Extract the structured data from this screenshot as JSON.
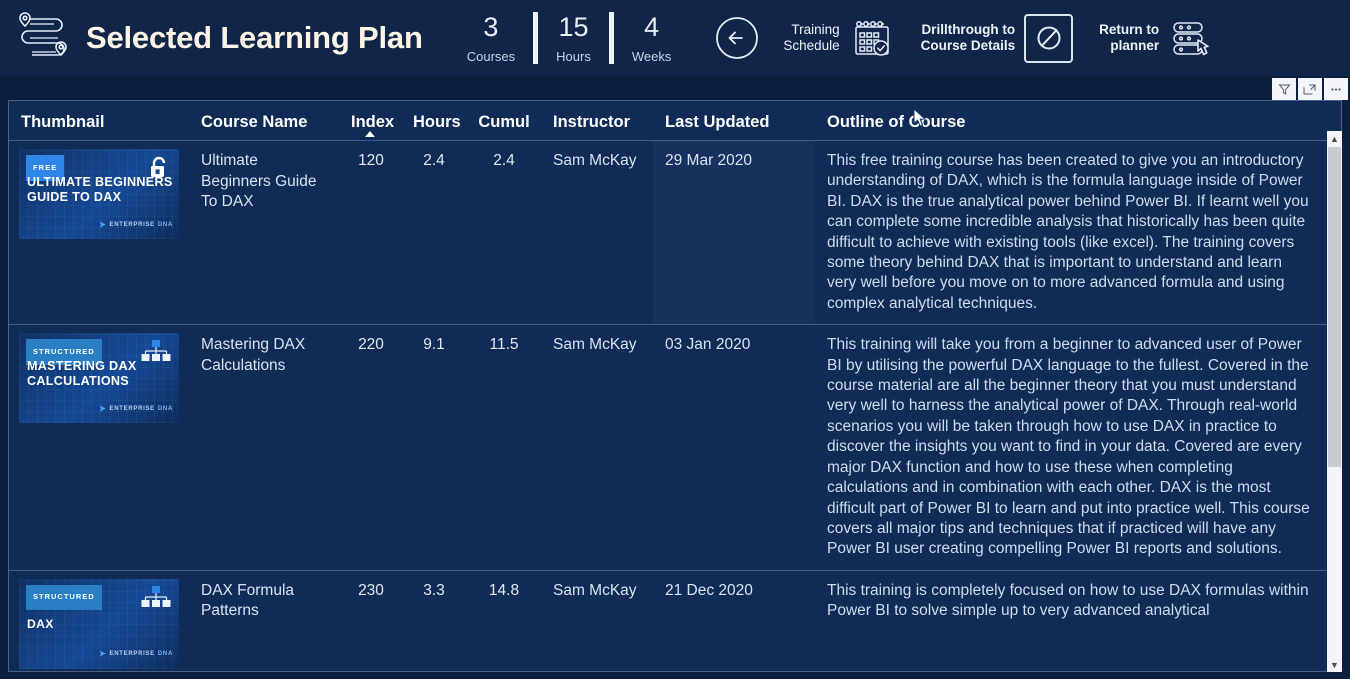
{
  "header": {
    "plan_icon": "route-plan-icon",
    "title": "Selected Learning Plan",
    "metrics": [
      {
        "value": "3",
        "label": "Courses"
      },
      {
        "value": "15",
        "label": "Hours"
      },
      {
        "value": "4",
        "label": "Weeks"
      }
    ],
    "back_button": {
      "name": "back-arrow-button"
    },
    "actions": [
      {
        "label": "Training\nSchedule",
        "bold": false,
        "icon": "calendar-check-icon",
        "framed": false
      },
      {
        "label": "Drillthrough to\nCourse Details",
        "bold": true,
        "icon": "no-entry-slash-icon",
        "framed": true
      },
      {
        "label": "Return to\nplanner",
        "bold": true,
        "icon": "database-click-icon",
        "framed": false
      }
    ]
  },
  "visual_tools": [
    {
      "name": "filter-icon",
      "glyph": "filter"
    },
    {
      "name": "focus-mode-icon",
      "glyph": "focus"
    },
    {
      "name": "more-options-icon",
      "glyph": "more"
    }
  ],
  "table": {
    "columns": [
      {
        "key": "thumbnail",
        "label": "Thumbnail",
        "align": "left",
        "sorted": false
      },
      {
        "key": "name",
        "label": "Course Name",
        "align": "left",
        "sorted": false
      },
      {
        "key": "index",
        "label": "Index",
        "align": "center",
        "sorted": "asc"
      },
      {
        "key": "hours",
        "label": "Hours",
        "align": "center",
        "sorted": false
      },
      {
        "key": "cumul",
        "label": "Cumul",
        "align": "center",
        "sorted": false
      },
      {
        "key": "instructor",
        "label": "Instructor",
        "align": "left",
        "sorted": false
      },
      {
        "key": "updated",
        "label": "Last Updated",
        "align": "left",
        "sorted": false
      },
      {
        "key": "outline",
        "label": "Outline of Course",
        "align": "left",
        "sorted": false
      }
    ],
    "rows": [
      {
        "thumbnail": {
          "badge": "FREE",
          "badge_type": "free",
          "title": "Ultimate Beginners Guide To DAX",
          "icon": "unlock-icon",
          "brand": "ENTERPRISE",
          "brand_suffix": "DNA"
        },
        "name": "Ultimate Beginners Guide To DAX",
        "index": "120",
        "hours": "2.4",
        "cumul": "2.4",
        "instructor": "Sam McKay",
        "updated": "29 Mar 2020",
        "updated_highlighted": true,
        "outline": "This free training course has been created to give you an introductory understanding of DAX, which is the formula language inside of Power BI. DAX is the true analytical power behind Power BI. If learnt well you can complete some incredible analysis that historically has been quite difficult to achieve with existing tools (like excel). The training covers some theory behind DAX that is important to understand and learn very well before you move on to more advanced formula and using complex analytical techniques."
      },
      {
        "thumbnail": {
          "badge": "STRUCTURED",
          "badge_type": "structured",
          "title": "Mastering DAX Calculations",
          "icon": "hierarchy-icon",
          "brand": "ENTERPRISE",
          "brand_suffix": "DNA"
        },
        "name": "Mastering DAX Calculations",
        "index": "220",
        "hours": "9.1",
        "cumul": "11.5",
        "instructor": "Sam McKay",
        "updated": "03 Jan 2020",
        "updated_highlighted": false,
        "outline": "This training will take you from a beginner to advanced user of Power BI by utilising the powerful DAX language to the fullest. Covered in the course material are all the beginner theory that you must understand very well to harness the analytical power of DAX. Through real-world scenarios you will be taken through how to use DAX in practice to discover the insights you want to find in your data. Covered are every major DAX function and how to use these when completing calculations and in combination with each other. DAX is the most difficult part of Power BI to learn and put into practice well. This course covers all major tips and techniques that if practiced will have any Power BI user creating compelling Power BI reports and solutions."
      },
      {
        "thumbnail": {
          "badge": "STRUCTURED",
          "badge_type": "structured",
          "title": "DAX",
          "icon": "hierarchy-icon",
          "brand": "ENTERPRISE",
          "brand_suffix": "DNA"
        },
        "name": "DAX Formula Patterns",
        "index": "230",
        "hours": "3.3",
        "cumul": "14.8",
        "instructor": "Sam McKay",
        "updated": "21 Dec 2020",
        "updated_highlighted": false,
        "outline": "This training is completely focused on how to use DAX formulas within Power BI to solve simple up to very advanced analytical"
      }
    ]
  },
  "scrollbar": {
    "name": "vertical-scrollbar",
    "up": "▲",
    "down": "▼"
  },
  "colors": {
    "page_background": "#0d1f3c",
    "header_background": "#102548",
    "table_background": "#0f2b56",
    "title_text": "#fdf6e6",
    "grid_line": "#3f5d90",
    "badge_free": "#2f86e8",
    "badge_structured": "#2a7ec4",
    "cell_highlight": "#16315e"
  }
}
